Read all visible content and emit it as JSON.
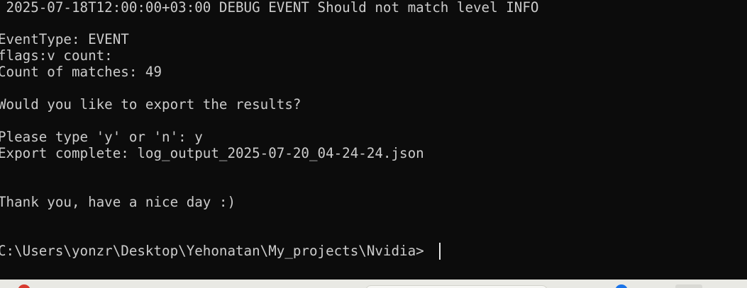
{
  "terminal": {
    "lines": [
      " 2025-07-18T12:00:00+03:00 DEBUG EVENT Should not match level INFO",
      "EventType: EVENT",
      "flags:v count:",
      "Count of matches: 49",
      "Would you like to export the results?",
      "Please type 'y' or 'n': y",
      "Export complete: log_output_2025-07-20_04-24-24.json",
      "Thank you, have a nice day :)",
      "C:\\Users\\yonzr\\Desktop\\Yehonatan\\My_projects\\Nvidia>"
    ],
    "text_color": "#cccccc",
    "background_color": "#0c0c0c"
  },
  "taskbar": {
    "background_color": "#e9e9e4",
    "icons": [
      "app-red-icon",
      "app-blue-icon"
    ]
  }
}
